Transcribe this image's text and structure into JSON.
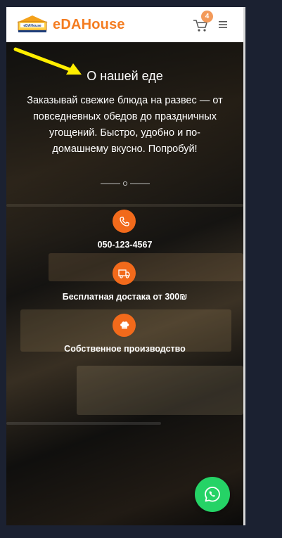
{
  "header": {
    "logo_text": "eDAHouse",
    "brand": "eDAHouse",
    "cart_count": "4"
  },
  "hero": {
    "title": "О нашей еде",
    "text": "Заказывай свежие блюда на развес — от повседневных обедов до праздничных угощений. Быстро, удобно и по-домашнему вкусно. Попробуй!"
  },
  "features": [
    {
      "icon": "phone-icon",
      "label": "050-123-4567"
    },
    {
      "icon": "truck-icon",
      "label": "Бесплатная достака от 300₪"
    },
    {
      "icon": "chef-hat-icon",
      "label": "Собственное производство"
    }
  ],
  "colors": {
    "brand": "#f47c20",
    "accent": "#f26a1b",
    "whatsapp": "#25d366",
    "annotation_arrow": "#ffee00"
  }
}
